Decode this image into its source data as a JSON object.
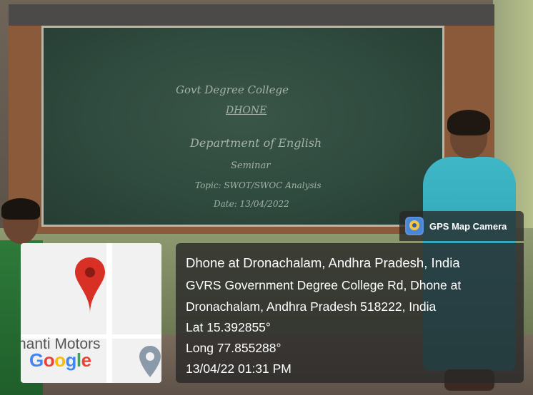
{
  "photo": {
    "chalkboard_lines": [
      "Govt Degree College",
      "DHONE",
      "Department of English",
      "Seminar",
      "Topic: SWOT/SWOC Analysis",
      "Date: 13/04/2022"
    ]
  },
  "map": {
    "place_label": "hanti Motors",
    "brand": {
      "g1": "G",
      "o1": "o",
      "o2": "o",
      "g2": "g",
      "l": "l",
      "e": "e"
    }
  },
  "badge": {
    "app_name": "GPS Map Camera",
    "icon": "gps-map-camera-icon"
  },
  "location": {
    "title": "Dhone at Dronachalam, Andhra Pradesh, India",
    "address_line1": "GVRS Government Degree College Rd, Dhone at",
    "address_line2": "Dronachalam, Andhra Pradesh 518222, India",
    "lat": "Lat 15.392855°",
    "long": "Long 77.855288°",
    "datetime": "13/04/22 01:31 PM"
  },
  "colors": {
    "pin": "#d93025",
    "overlay": "#282828",
    "board": "#2f4a3e"
  }
}
